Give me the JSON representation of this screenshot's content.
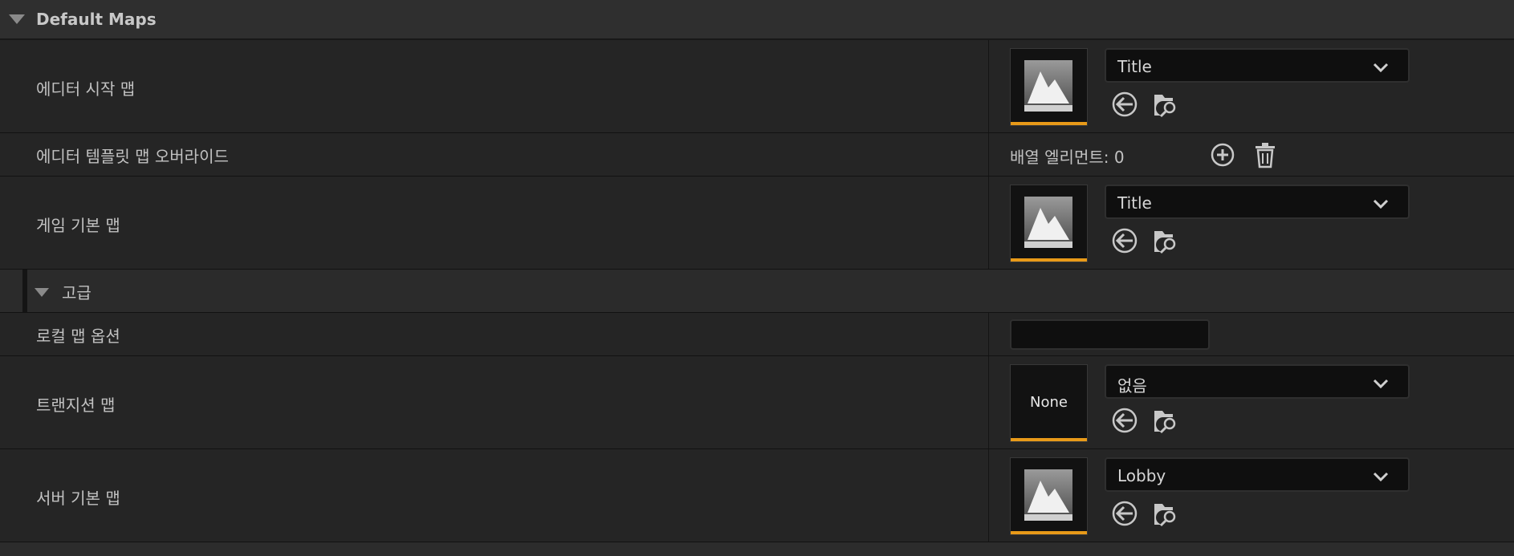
{
  "section": {
    "title": "Default Maps"
  },
  "rows": {
    "editor_startup_map": {
      "label": "에디터 시작 맵",
      "value": "Title"
    },
    "editor_template_override": {
      "label": "에디터 템플릿 맵 오버라이드",
      "array_text": "배열 엘리먼트: 0"
    },
    "game_default_map": {
      "label": "게임 기본 맵",
      "value": "Title"
    },
    "advanced": {
      "label": "고급"
    },
    "local_map_options": {
      "label": "로컬 맵 옵션",
      "value": ""
    },
    "transition_map": {
      "label": "트랜지션 맵",
      "thumb_text": "None",
      "value": "없음"
    },
    "server_default_map": {
      "label": "서버 기본 맵",
      "value": "Lobby"
    }
  },
  "colors": {
    "accent": "#e89a19",
    "row_bg": "#252525",
    "header_bg": "#2f2f2f"
  },
  "icons": [
    "chevron-down-icon",
    "use-selected-arrow-icon",
    "browse-folder-icon",
    "add-element-icon",
    "trash-icon",
    "map-thumbnail-icon"
  ]
}
